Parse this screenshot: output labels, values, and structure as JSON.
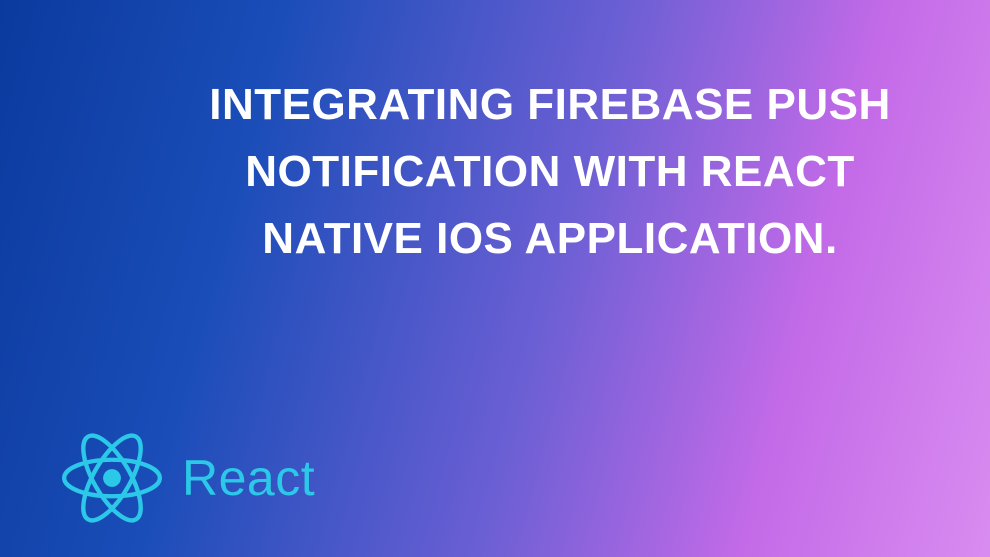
{
  "banner": {
    "title": "INTEGRATING FIREBASE PUSH NOTIFICATION WITH REACT NATIVE IOS APPLICATION.",
    "logo_label": "React",
    "logo_color": "#2bc8e8"
  }
}
